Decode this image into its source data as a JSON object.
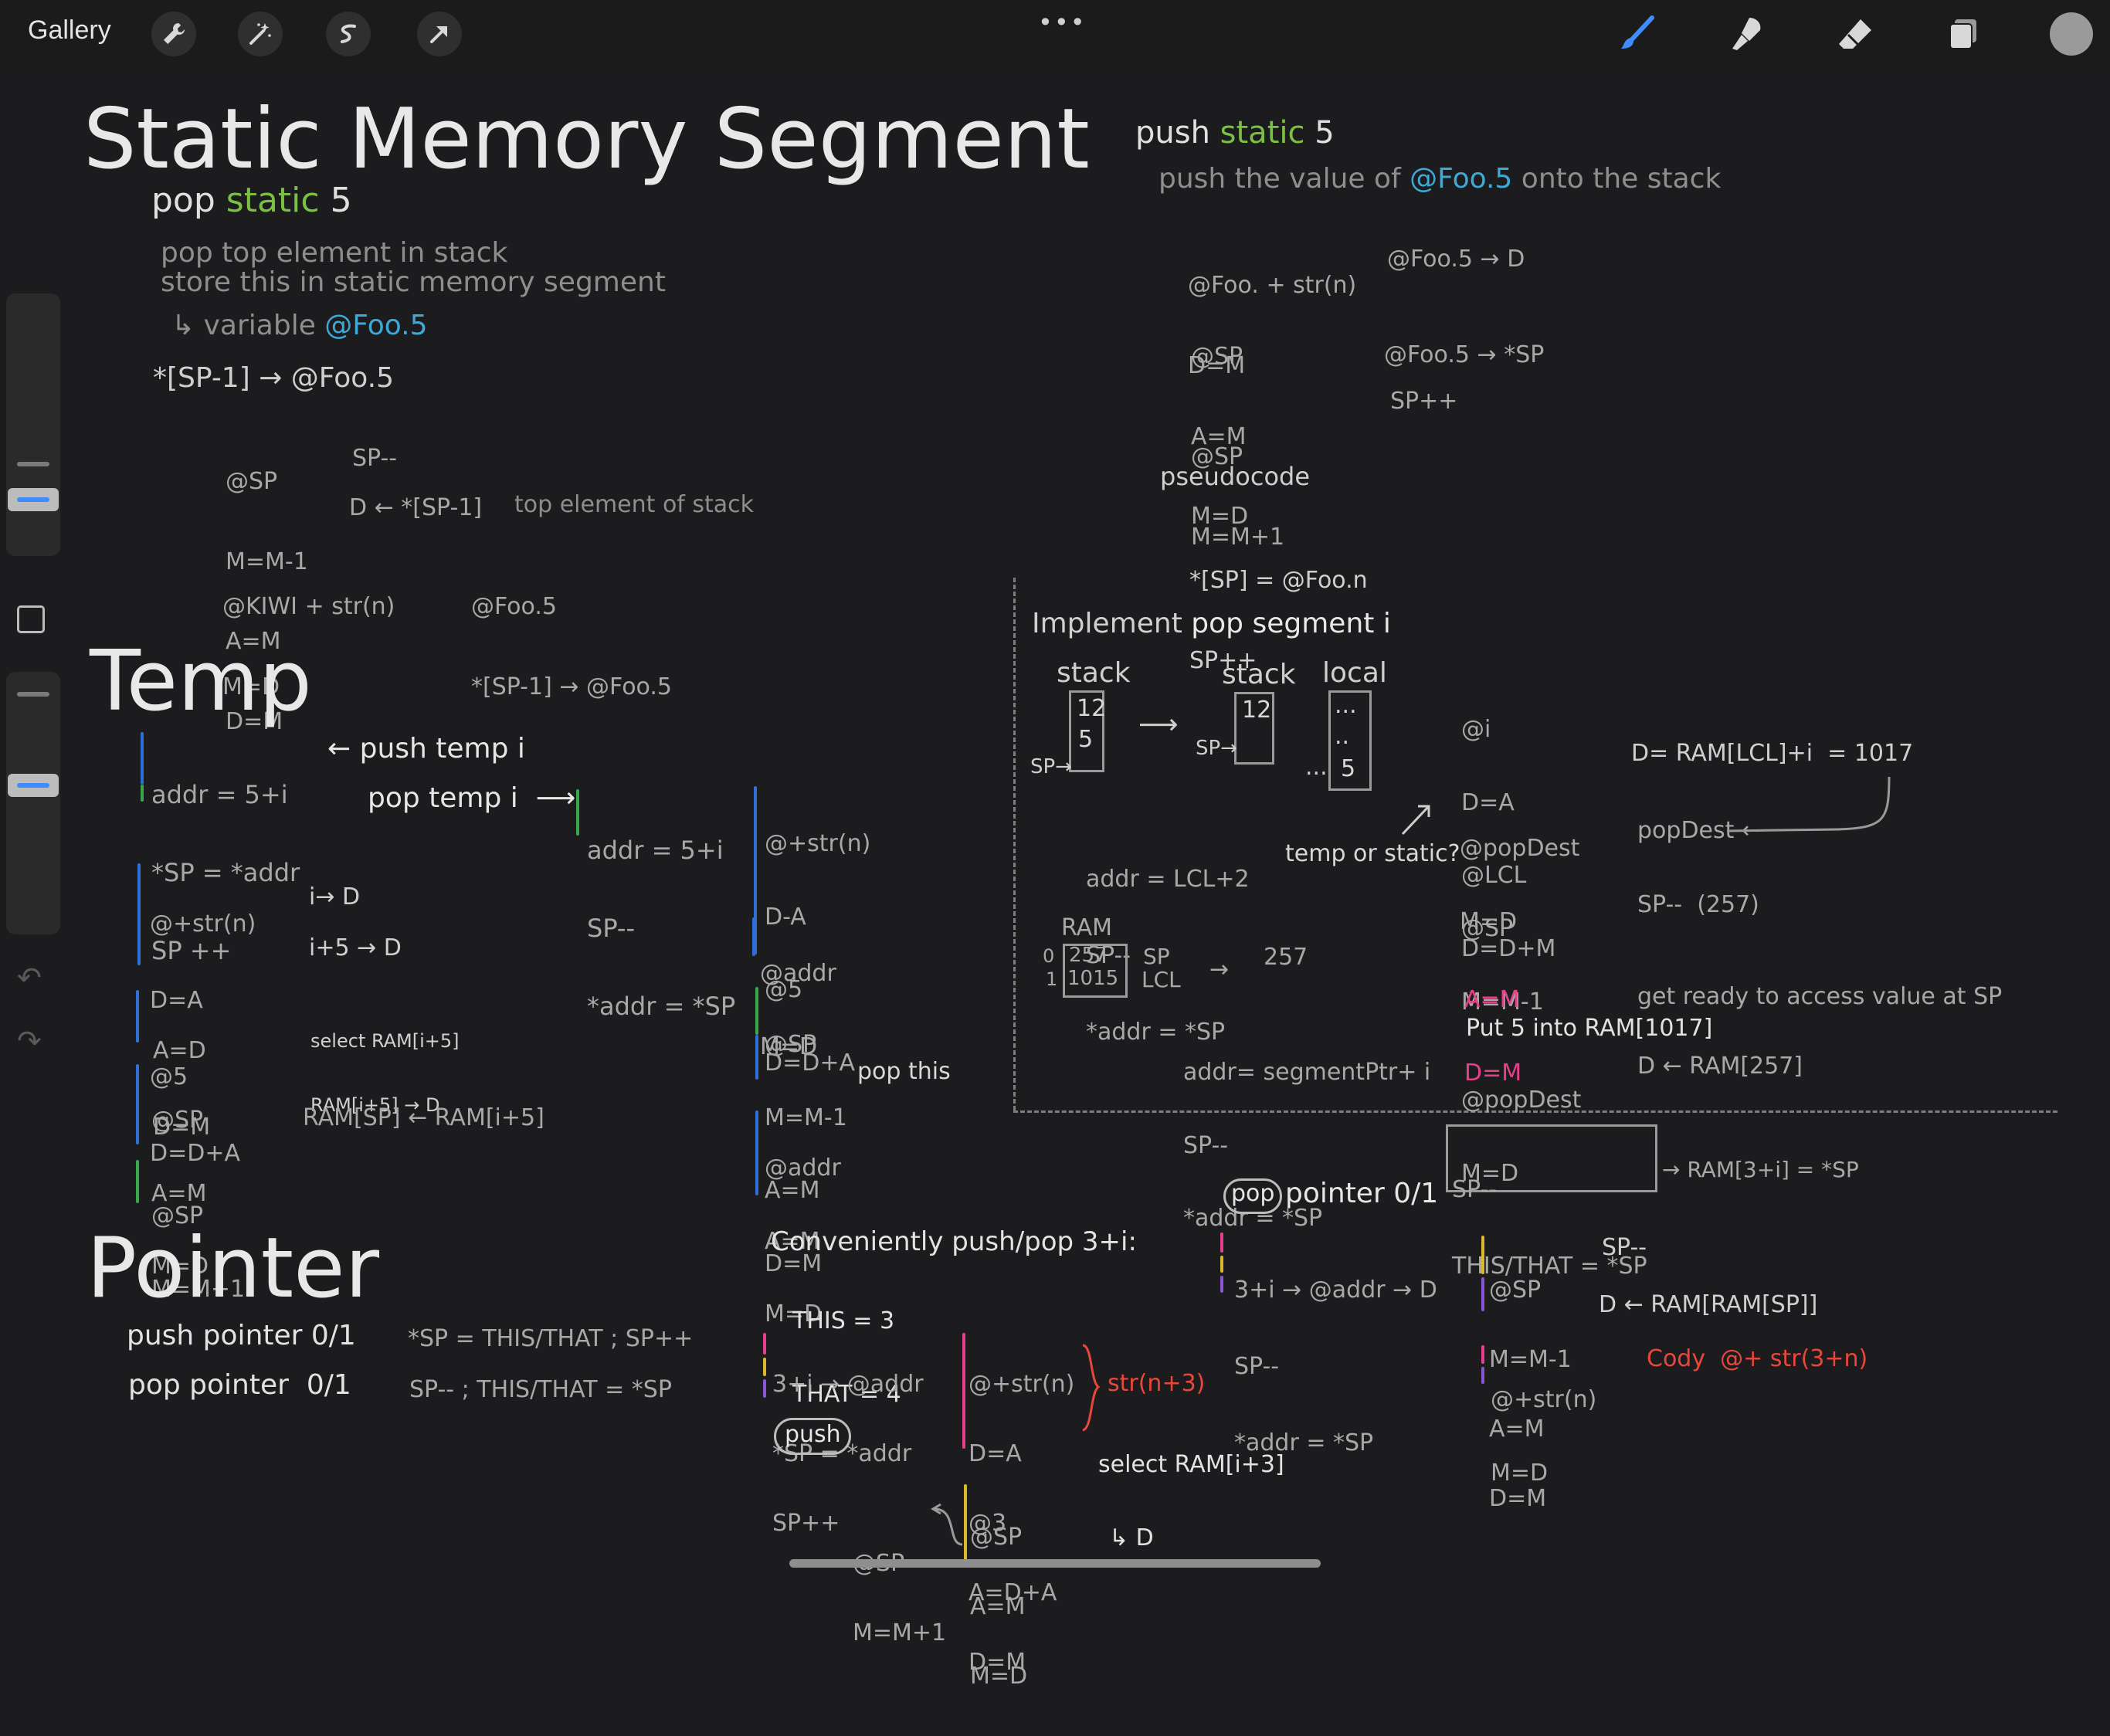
{
  "toolbar": {
    "gallery": "Gallery",
    "left_tools": [
      "wrench-icon",
      "magic-wand-icon",
      "selection-icon",
      "transform-arrow-icon"
    ],
    "more": "•••",
    "right_tools": [
      "brush-icon",
      "smudge-icon",
      "eraser-icon",
      "layers-icon",
      "color-icon"
    ],
    "colors": {
      "accent": "#3f8cff",
      "active_color": "#9a9a9a"
    }
  },
  "sidebar": {
    "undo": "↶",
    "redo": "↷"
  },
  "notes": {
    "title": "Static Memory Segment",
    "pop_static": {
      "pop": "pop",
      "static": "static",
      "num": "5"
    },
    "pop_desc1": "pop top element in stack",
    "pop_desc2": "store this in static memory segment",
    "variable_a": "↳ variable",
    "variable_b": "@Foo.5",
    "sp_line": "*[SP-1] → @Foo.5",
    "asm1": [
      "@SP",
      "M=M-1",
      "A=M",
      "D=M"
    ],
    "asm1_note_a": "SP--",
    "asm1_note_b": "D ← *[SP-1]",
    "asm1_note_c": "top element of stack",
    "asm2": [
      "@KIWI + str(n)",
      "M=D"
    ],
    "asm2_note": [
      "@Foo.5",
      "*[SP-1] → @Foo.5"
    ],
    "push_static": {
      "push": "push",
      "static": "static",
      "num": "5"
    },
    "push_desc_a": "push the value of",
    "push_desc_b": "@Foo.5",
    "push_desc_c": "onto the stack",
    "push_asm1": [
      "@Foo. + str(n)",
      "D=M"
    ],
    "push_asm1_note": "@Foo.5 → D",
    "push_asm2": [
      "@SP",
      "A=M",
      "M=D"
    ],
    "push_asm2_note": "@Foo.5 → *SP",
    "push_asm3": [
      "@SP",
      "M=M+1"
    ],
    "push_asm3_note": "SP++",
    "pseudocode_label": "pseudocode",
    "pseudocode": [
      "*[SP] = @Foo.n",
      "SP++"
    ],
    "temp_title": "Temp",
    "temp_push_lines": [
      "addr = 5+i",
      "*SP = *addr",
      "SP ++"
    ],
    "push_temp": "← push temp i",
    "pop_temp": "pop temp i  ⟶",
    "pop_temp_lines": [
      "addr = 5+i",
      "SP--",
      "*addr = *SP"
    ],
    "temp_asm1": [
      "@+str(n)",
      "D=A",
      "@5",
      "D=D+A"
    ],
    "temp_asm1_notes": [
      "i→ D",
      "i+5 → D"
    ],
    "temp_asm2": [
      "A=D",
      "D=M"
    ],
    "temp_asm2_notes": [
      "select RAM[i+5]",
      "RAM[i+5] → D"
    ],
    "temp_asm3": [
      "@SP",
      "A=M",
      "M=D"
    ],
    "temp_asm3_note": "RAM[SP] ← RAM[i+5]",
    "temp_asm4": [
      "@SP",
      "M=M+1"
    ],
    "col2_a": [
      "@+str(n)",
      "D-A",
      "@5",
      "D=D+A"
    ],
    "col2_b": [
      "@addr",
      "M=D"
    ],
    "col2_c": [
      "@SP",
      "M=M-1",
      "A=M",
      "D=M"
    ],
    "col2_c_note": "pop this",
    "col2_d": [
      "@addr",
      "A=M",
      "M=D"
    ],
    "implement_a": "Implement",
    "implement_b": "pop segment i",
    "stack_label": "stack",
    "stack_cells1": [
      "12",
      "5"
    ],
    "stack_cells2": [
      "12"
    ],
    "local_label": "local",
    "local_cells": [
      "...",
      "..",
      "5"
    ],
    "sp_label": "SP→",
    "local_dots": "...",
    "impl_asm1": [
      "@i",
      "D=A",
      "@LCL",
      "D=D+M"
    ],
    "impl_ram_eq": "D= RAM[LCL]+i  = 1017",
    "impl_asm2": [
      "@popDest",
      "M=D"
    ],
    "impl_popdest": "popDest ←",
    "addr_lcl": [
      "addr = LCL+2",
      "SP--",
      "*addr = *SP"
    ],
    "temp_or_static": "temp or static?",
    "impl_asm3": [
      "@SP",
      "M=M-1"
    ],
    "impl_asm3_note": "SP--  (257)",
    "impl_asm4": [
      "A=M",
      "D=M"
    ],
    "impl_asm4_note": [
      "get ready to access value at SP",
      "D ← RAM[257]"
    ],
    "ram_label": "RAM",
    "ram_idx": [
      "0",
      "1"
    ],
    "ram_vals": [
      "257",
      "1015"
    ],
    "ram_names": [
      "SP",
      "LCL"
    ],
    "ram_arrow": "→",
    "ram_257": "257",
    "addr_seg": [
      "addr= segmentPtr+ i",
      "SP--",
      "*addr = *SP"
    ],
    "put5": "Put 5 into RAM[1017]",
    "impl_asm5": [
      "@popDest",
      "M=D"
    ],
    "box_lines": [
      "SP--",
      "THIS/THAT = *SP"
    ],
    "box_arrow": "→ RAM[3+i] = *SP",
    "pop_pointer_a": "pop",
    "pop_pointer_b": "pointer 0/1",
    "pointer_title": "Pointer",
    "push_pointer": "push pointer 0/1",
    "pop_pointer": "pop pointer  0/1",
    "push_pointer_note": "*SP = THIS/THAT ; SP++",
    "pop_pointer_note": "SP-- ; THIS/THAT = *SP",
    "conveniently": "Conveniently push/pop 3+i:",
    "this_that": [
      "THIS = 3",
      "THAT = 4"
    ],
    "push_ptr_lines": [
      "3+i → @addr",
      "*SP = *addr",
      "SP++"
    ],
    "push_pill": "push",
    "ptr_asm1": [
      "@+str(n)",
      "D=A",
      "@3",
      "A=D+A",
      "D=M"
    ],
    "str_n3": "str(n+3)",
    "select_ram": [
      "select RAM[i+3]",
      "↳ D"
    ],
    "ptr_asm2": [
      "@SP",
      "A=M",
      "M=D"
    ],
    "ptr_asm3": [
      "@SP",
      "M=M+1"
    ],
    "popptr_lines": [
      "3+i → @addr → D",
      "SP--",
      "*addr = *SP"
    ],
    "popptr_asm1": [
      "@SP",
      "M=M-1",
      "A=M",
      "D=M"
    ],
    "popptr_asm1_notes": [
      "SP--",
      "D ← RAM[RAM[SP]]"
    ],
    "popptr_asm2": [
      "@+str(n)",
      "M=D"
    ],
    "popptr_asm2_note": "Cody  @+ str(3+n)"
  }
}
